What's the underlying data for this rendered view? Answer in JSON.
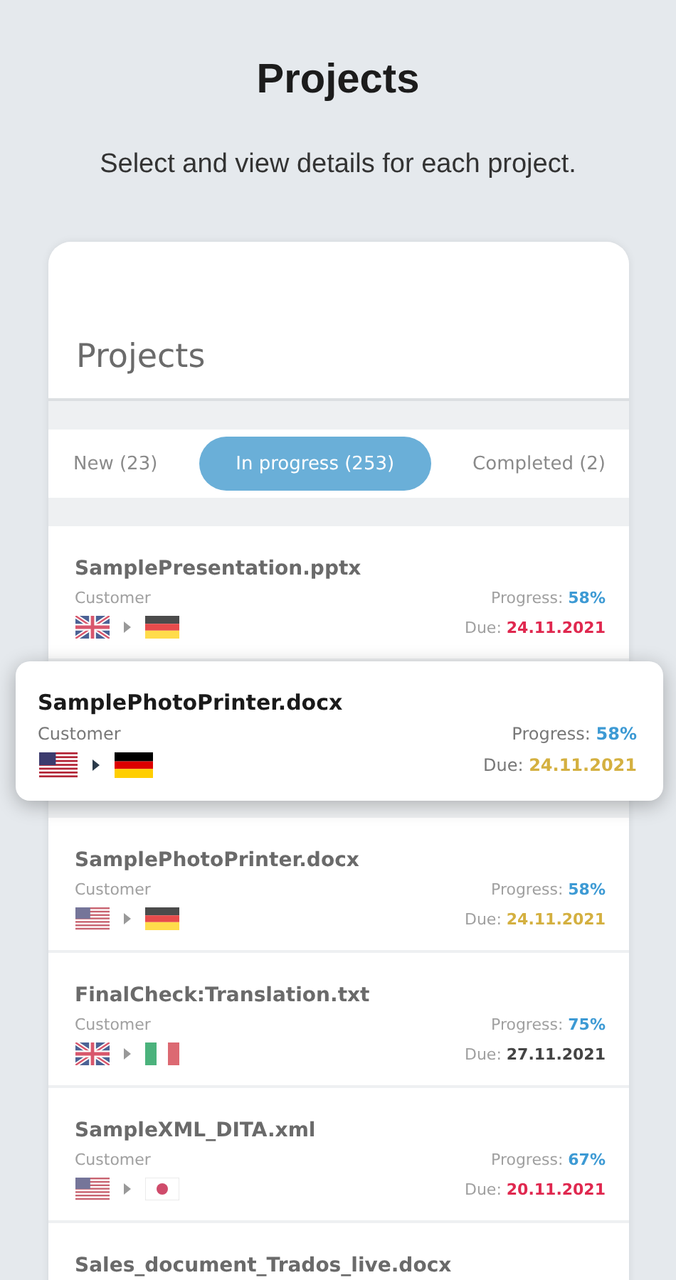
{
  "heading": "Projects",
  "subheading": "Select and view details for each project.",
  "app": {
    "title": "Projects",
    "tabs": [
      {
        "label": "New (23)",
        "selected": false
      },
      {
        "label": "In progress (253)",
        "selected": true
      },
      {
        "label": "Completed (2)",
        "selected": false
      }
    ],
    "projects": [
      {
        "name": "SamplePresentation.pptx",
        "customer": "Customer",
        "progress_label": "Progress:",
        "progress": "58%",
        "source": {
          "kind": "uk"
        },
        "target": {
          "kind": "de"
        },
        "due_label": "Due:",
        "due": "24.11.2021",
        "color": "#e0284f",
        "lifted": false
      },
      {
        "name": "SamplePhotoPrinter.docx",
        "customer": "Customer",
        "progress_label": "Progress:",
        "progress": "58%",
        "source": {
          "kind": "us"
        },
        "target": {
          "kind": "de"
        },
        "due_label": "Due:",
        "due": "24.11.2021",
        "color": "#d4b040",
        "lifted": true
      },
      {
        "name": "SamplePhotoPrinter.docx",
        "customer": "Customer",
        "progress_label": "Progress:",
        "progress": "58%",
        "source": {
          "kind": "us"
        },
        "target": {
          "kind": "de"
        },
        "due_label": "Due:",
        "due": "24.11.2021",
        "color": "#d4b040",
        "lifted": false
      },
      {
        "name": "FinalCheck:Translation.txt",
        "customer": "Customer",
        "progress_label": "Progress:",
        "progress": "75%",
        "source": {
          "kind": "uk"
        },
        "target": {
          "kind": "it"
        },
        "due_label": "Due:",
        "due": "27.11.2021",
        "color": "#444444",
        "lifted": false
      },
      {
        "name": "SampleXML_DITA.xml",
        "customer": "Customer",
        "progress_label": "Progress:",
        "progress": "67%",
        "source": {
          "kind": "us"
        },
        "target": {
          "kind": "jp"
        },
        "due_label": "Due:",
        "due": "20.11.2021",
        "color": "#e0284f",
        "lifted": false
      },
      {
        "name": "Sales_document_Trados_live.docx",
        "lifted": false
      }
    ]
  }
}
